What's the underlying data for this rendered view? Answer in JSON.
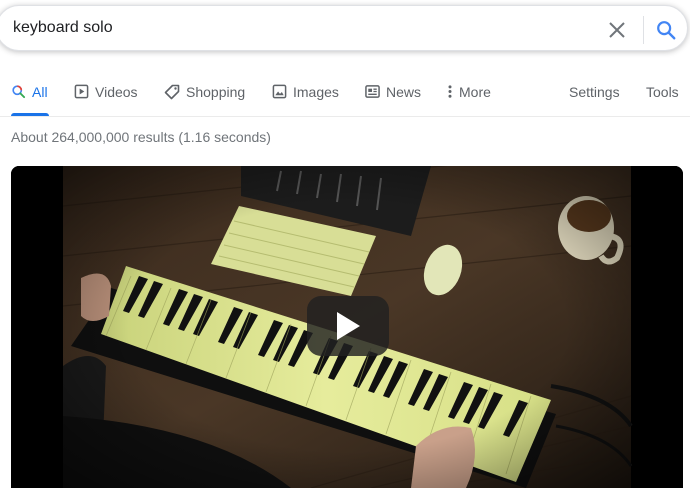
{
  "search": {
    "query": "keyboard solo"
  },
  "tabs": [
    {
      "label": "All",
      "icon": "search-icon",
      "active": true
    },
    {
      "label": "Videos",
      "icon": "video-play-icon"
    },
    {
      "label": "Shopping",
      "icon": "tag-icon"
    },
    {
      "label": "Images",
      "icon": "image-icon"
    },
    {
      "label": "News",
      "icon": "newspaper-icon"
    },
    {
      "label": "More",
      "icon": "more-vert-icon"
    },
    {
      "label": "Settings"
    },
    {
      "label": "Tools"
    }
  ],
  "results": {
    "stats": "About 264,000,000 results (1.16 seconds)"
  },
  "video": {
    "description": "keyboard and mouse on desk, hands playing a piano keyboard, coffee mug"
  },
  "colors": {
    "accent": "#1a73e8",
    "tab_text": "#5f6368",
    "stats_text": "#70757a"
  }
}
